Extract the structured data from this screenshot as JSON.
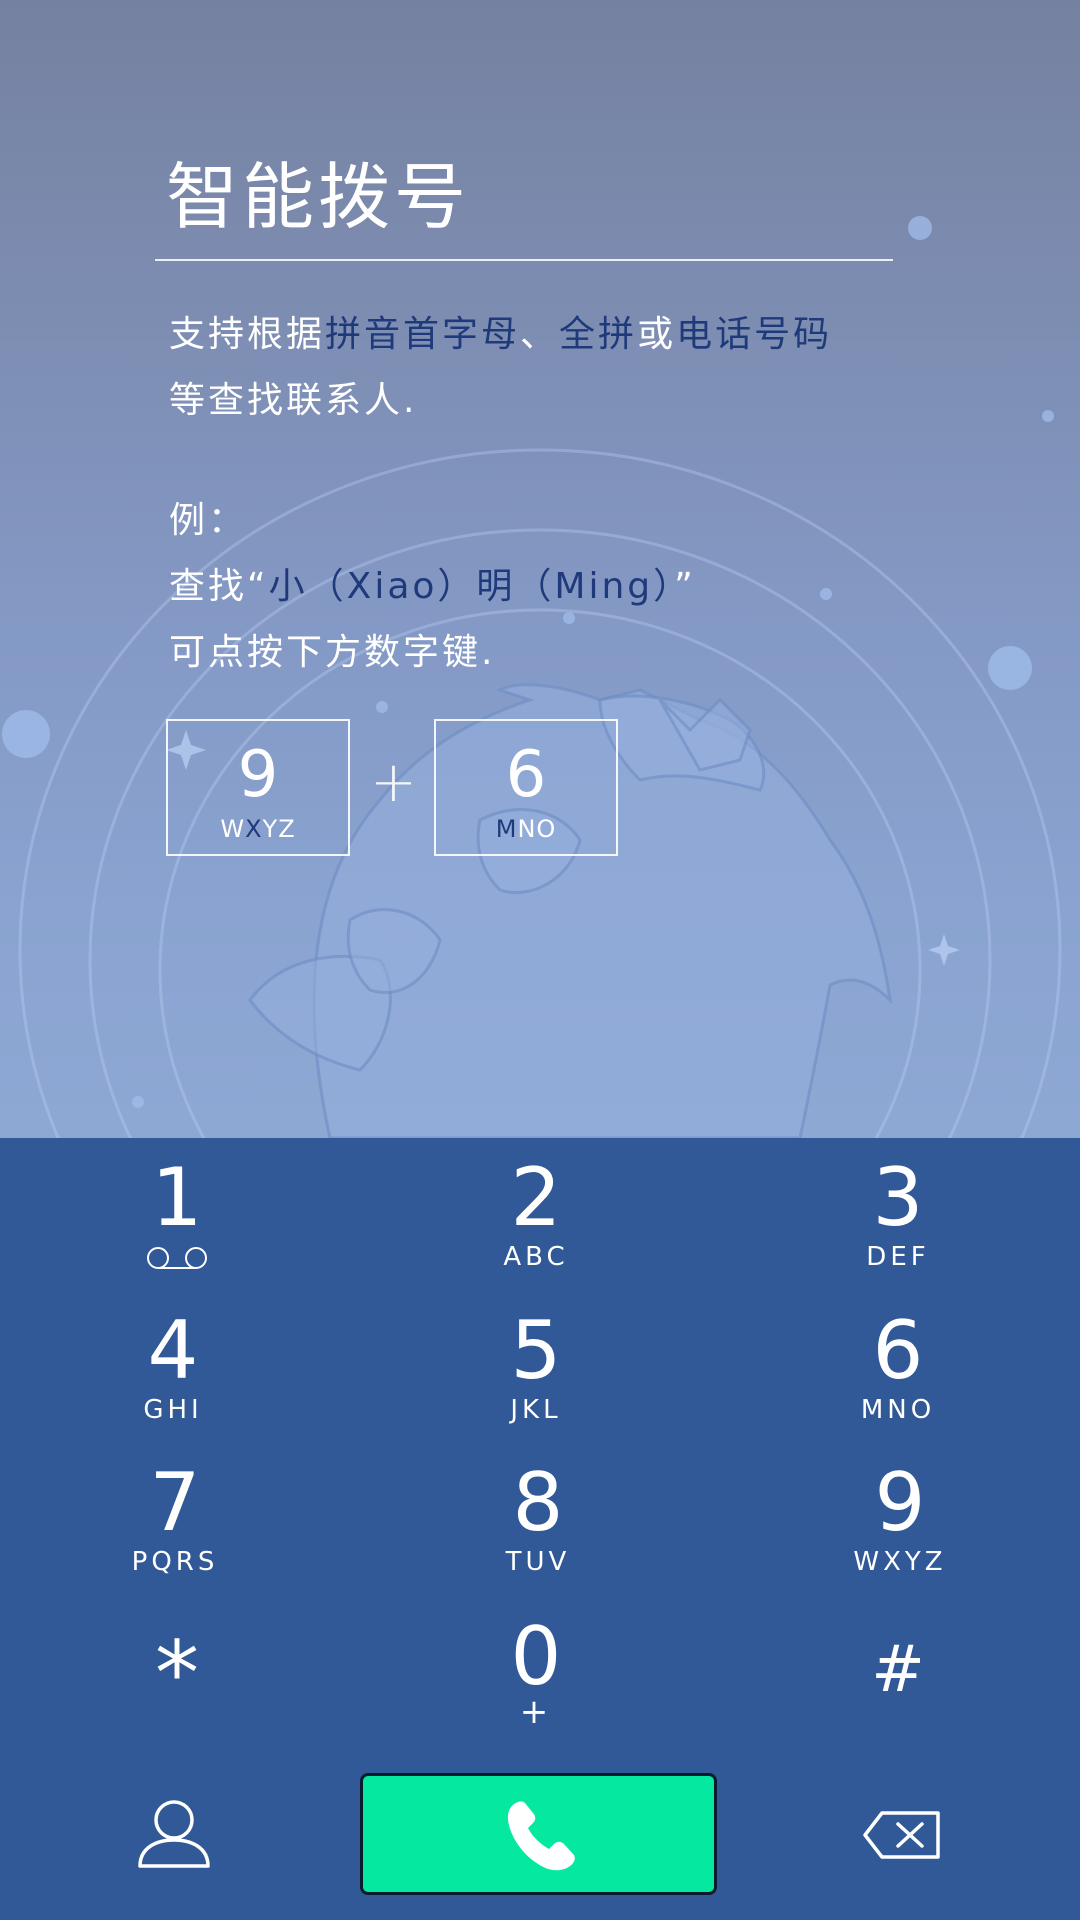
{
  "tutorial": {
    "title": "智能拨号",
    "desc_parts": {
      "p1": "支持根据",
      "p2": "拼音首字母",
      "p3": "、",
      "p4": "全拼",
      "p5": "或",
      "p6": "电话号码",
      "p7": "等查找联系人."
    },
    "example_label": "例：",
    "example_line2_parts": {
      "a": "查找“",
      "b": "小（Xiao）明（Ming）",
      "c": "”"
    },
    "example_line3": "可点按下方数字键.",
    "demo_keys": [
      {
        "digit": "9",
        "letters_pre": "W",
        "letters_hl": "X",
        "letters_post": "YZ"
      },
      {
        "digit": "6",
        "letters_pre": "",
        "letters_hl": "M",
        "letters_post": "NO"
      }
    ],
    "plus": "+"
  },
  "dialpad": {
    "keys": [
      {
        "digit": "1",
        "letters": "",
        "icon": "voicemail-icon"
      },
      {
        "digit": "2",
        "letters": "ABC"
      },
      {
        "digit": "3",
        "letters": "DEF"
      },
      {
        "digit": "4",
        "letters": "GHI"
      },
      {
        "digit": "5",
        "letters": "JKL"
      },
      {
        "digit": "6",
        "letters": "MNO"
      },
      {
        "digit": "7",
        "letters": "PQRS"
      },
      {
        "digit": "8",
        "letters": "TUV"
      },
      {
        "digit": "9",
        "letters": "WXYZ"
      },
      {
        "digit": "*",
        "letters": ""
      },
      {
        "digit": "0",
        "letters": "+"
      },
      {
        "digit": "#",
        "letters": ""
      }
    ],
    "bottom": {
      "contacts_icon": "person-icon",
      "call_icon": "phone-icon",
      "delete_icon": "backspace-icon"
    }
  },
  "colors": {
    "pad_background": "#315897",
    "call_button": "#05e8a0",
    "highlight_text": "#1f3a7a"
  }
}
